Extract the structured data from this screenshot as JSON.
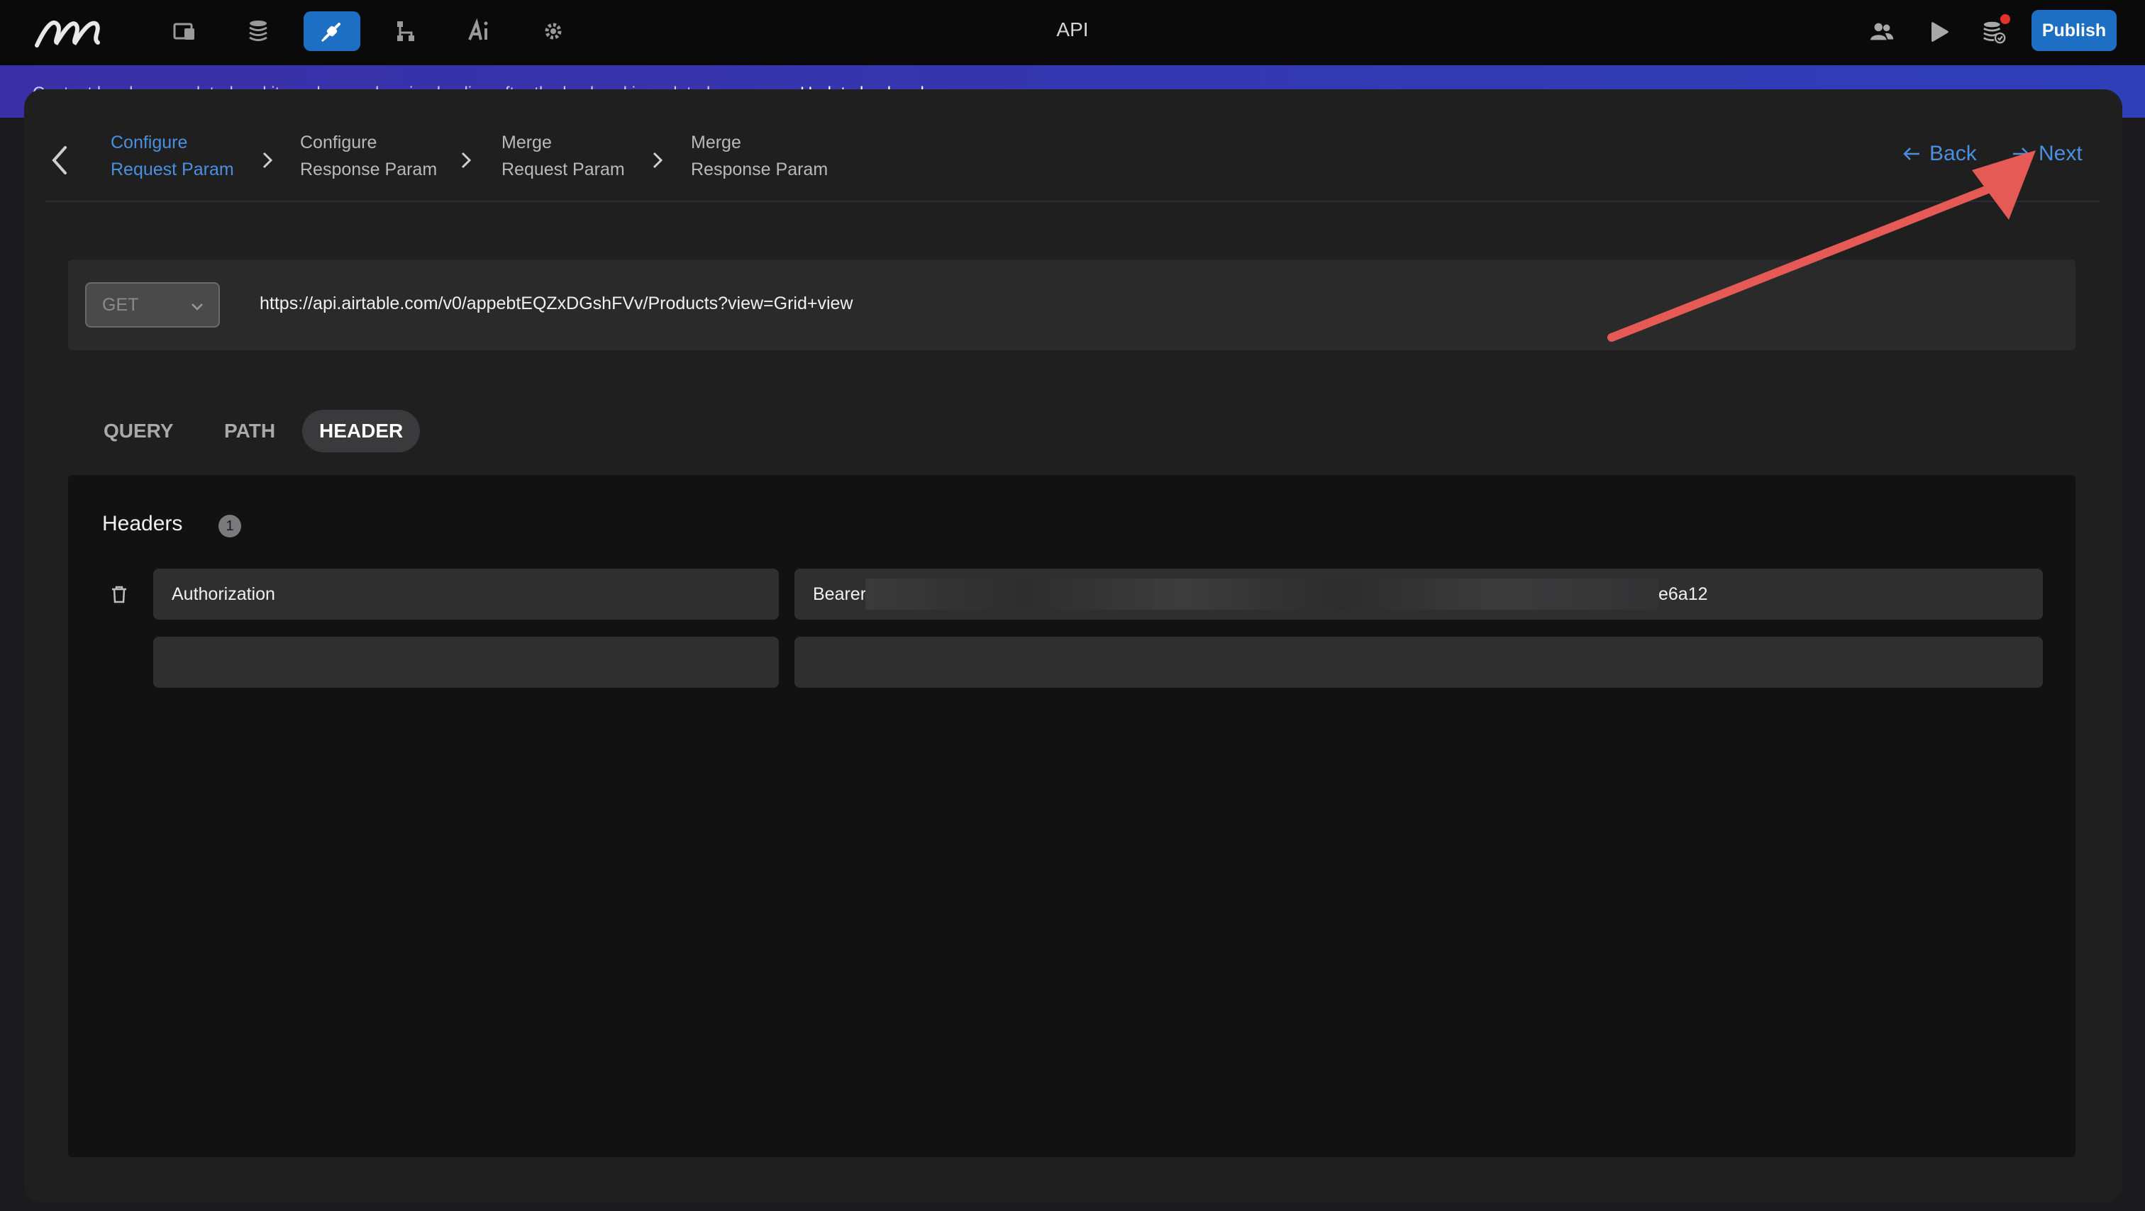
{
  "topbar": {
    "title": "API",
    "publish_label": "Publish",
    "nav_icons": [
      "pages-icon",
      "database-icon",
      "api-icon",
      "workflow-icon",
      "ai-icon",
      "settings-icon"
    ],
    "active_nav": "api-icon",
    "right_icons": [
      "users-icon",
      "play-icon",
      "backend-sync-icon"
    ]
  },
  "banner": {
    "text": "Content has been updated and it can be synchronized online after the backend is updated.",
    "link": "Update backend"
  },
  "wizard": {
    "steps": [
      {
        "line1": "Configure",
        "line2": "Request Param",
        "active": true
      },
      {
        "line1": "Configure",
        "line2": "Response Param",
        "active": false
      },
      {
        "line1": "Merge",
        "line2": "Request Param",
        "active": false
      },
      {
        "line1": "Merge",
        "line2": "Response Param",
        "active": false
      }
    ],
    "back_label": "Back",
    "next_label": "Next"
  },
  "request": {
    "method": "GET",
    "url": "https://api.airtable.com/v0/appebtEQZxDGshFVv/Products?view=Grid+view"
  },
  "tabs": [
    {
      "label": "QUERY",
      "active": false
    },
    {
      "label": "PATH",
      "active": false
    },
    {
      "label": "HEADER",
      "active": true
    }
  ],
  "headers": {
    "title": "Headers",
    "count": "1",
    "rows": [
      {
        "key": "Authorization",
        "value_prefix": "Bearer",
        "value_suffix": "e6a12"
      },
      {
        "key": "",
        "value_prefix": "",
        "value_suffix": ""
      }
    ]
  },
  "colors": {
    "accent": "#4a8fe0",
    "primary_button": "#1d6fc4",
    "annotation_arrow": "#e65a55"
  }
}
